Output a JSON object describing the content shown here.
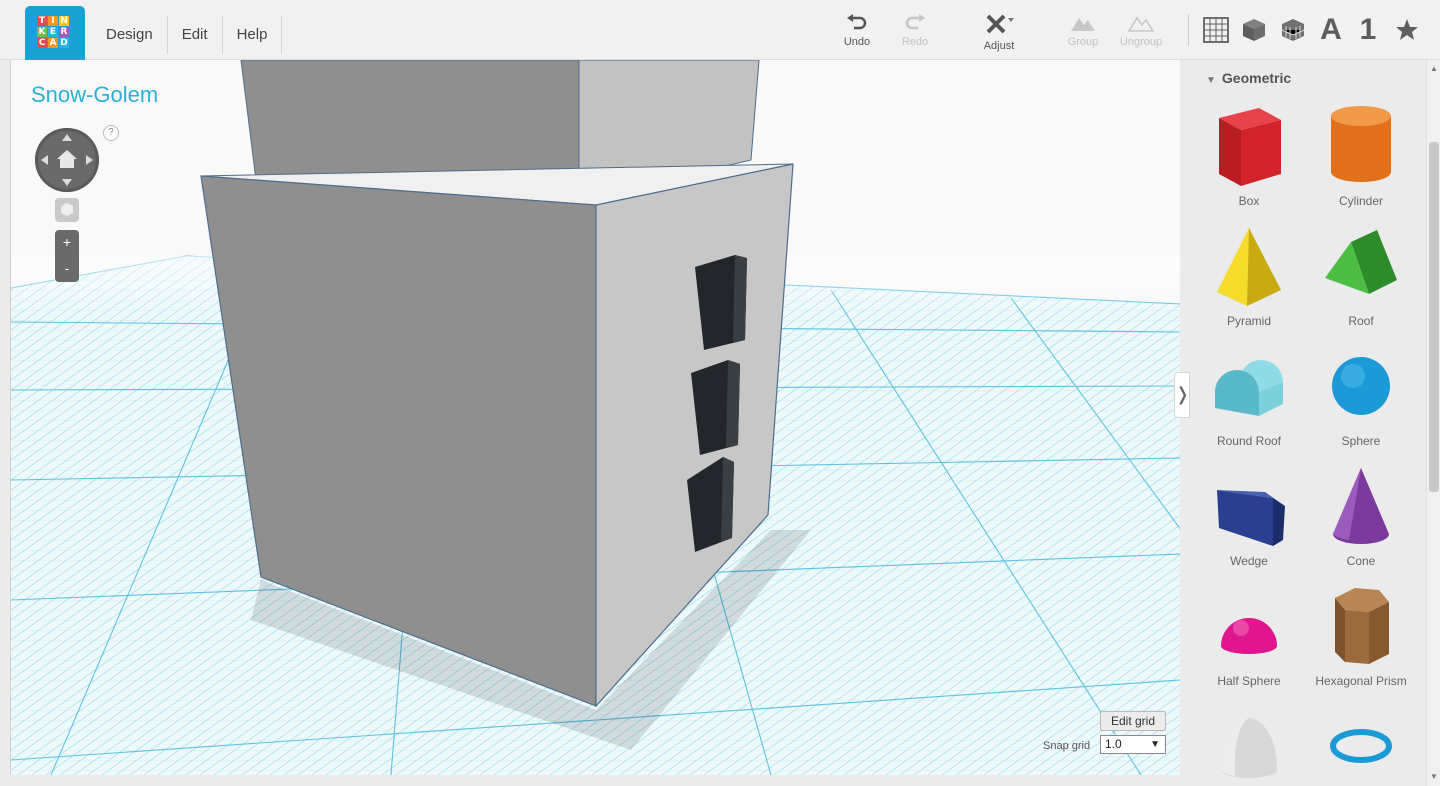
{
  "app": {
    "logo_letters": [
      "T",
      "I",
      "N",
      "K",
      "E",
      "R",
      "C",
      "A",
      "D"
    ]
  },
  "menu": {
    "design": "Design",
    "edit": "Edit",
    "help": "Help"
  },
  "toolbar": {
    "undo": "Undo",
    "redo": "Redo",
    "adjust": "Adjust",
    "group": "Group",
    "ungroup": "Ungroup"
  },
  "right_tools": {
    "letters_label": "A",
    "numbers_label": "1",
    "icons": [
      "grid-icon",
      "box-icon",
      "cube-pattern-icon",
      "letters-icon",
      "numbers-icon",
      "star-icon"
    ]
  },
  "workplane": {
    "design_name": "Snow-Golem",
    "help_label": "?",
    "zoom_in": "+",
    "zoom_out": "-",
    "edit_grid": "Edit grid",
    "snap_grid_label": "Snap grid",
    "snap_grid_value": "1.0",
    "snap_grid_arrow": "▼",
    "collapse_arrow": "❭"
  },
  "sidebar": {
    "category": "Geometric",
    "category_arrow": "▼",
    "shapes": [
      {
        "label": "Box",
        "color": "#d2232a"
      },
      {
        "label": "Cylinder",
        "color": "#e8791d"
      },
      {
        "label": "Pyramid",
        "color": "#f2d31a"
      },
      {
        "label": "Roof",
        "color": "#3da535"
      },
      {
        "label": "Round Roof",
        "color": "#6cc9d6"
      },
      {
        "label": "Sphere",
        "color": "#1b9ad6"
      },
      {
        "label": "Wedge",
        "color": "#2a3f8f"
      },
      {
        "label": "Cone",
        "color": "#7a3a9c"
      },
      {
        "label": "Half Sphere",
        "color": "#e0168e"
      },
      {
        "label": "Hexagonal Prism",
        "color": "#9b6a3d"
      },
      {
        "label": "",
        "color": "#d8d8d8"
      },
      {
        "label": "",
        "color": "#1b9ad6"
      }
    ]
  },
  "scrollbar": {
    "up": "▲",
    "down": "▼"
  }
}
